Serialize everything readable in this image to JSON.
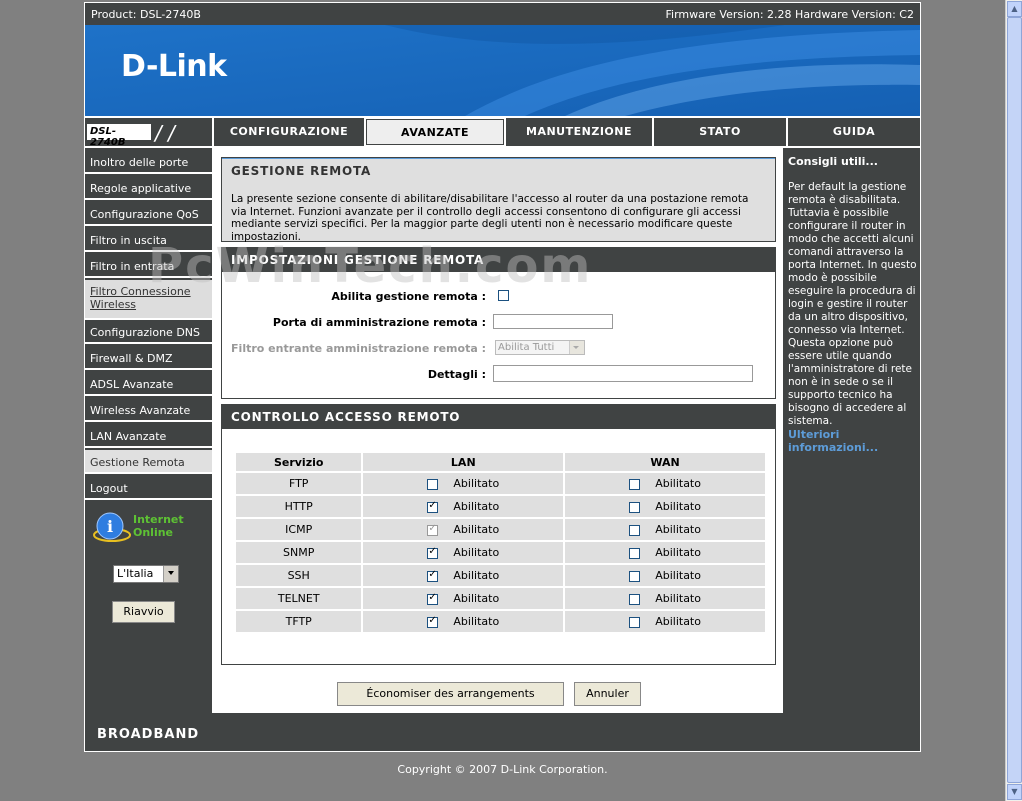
{
  "topbar": {
    "product": "Product: DSL-2740B",
    "versions": "Firmware Version: 2.28 Hardware Version: C2"
  },
  "banner": {
    "logo": "D-Link"
  },
  "tabs": {
    "model": "DSL-2740B",
    "items": [
      "CONFIGURAZIONE",
      "AVANZATE",
      "MANUTENZIONE",
      "STATO",
      "GUIDA"
    ],
    "active": "AVANZATE"
  },
  "leftnav": {
    "items": [
      "Inoltro delle porte",
      "Regole applicative",
      "Configurazione QoS",
      "Filtro in uscita",
      "Filtro in entrata",
      "Filtro Connessione Wireless",
      "Configurazione DNS",
      "Firewall & DMZ",
      "ADSL Avanzate",
      "Wireless Avanzate",
      "LAN Avanzate",
      "Gestione Remota",
      "Logout"
    ],
    "status_line1": "Internet",
    "status_line2": "Online",
    "language": "L'Italia",
    "reboot": "Riavvio"
  },
  "intro": {
    "title": "GESTIONE REMOTA",
    "text": "La presente sezione consente di abilitare/disabilitare l'accesso al router da una postazione remota via Internet. Funzioni avanzate per il controllo degli accessi consentono di configurare gli accessi mediante servizi specifici. Per la maggior parte degli utenti non è necessario modificare queste impostazioni."
  },
  "settings": {
    "title": "IMPOSTAZIONI GESTIONE REMOTA",
    "enable_label": "Abilita gestione remota :",
    "port_label": "Porta di amministrazione remota :",
    "port_value": "",
    "filter_label": "Filtro entrante amministrazione remota :",
    "filter_value": "Abilita Tutti",
    "details_label": "Dettagli :",
    "details_value": ""
  },
  "access": {
    "title": "CONTROLLO ACCESSO REMOTO",
    "headers": [
      "Servizio",
      "LAN",
      "WAN"
    ],
    "enabled_label": "Abilitato",
    "rows": [
      {
        "service": "FTP",
        "lan": false,
        "wan": false
      },
      {
        "service": "HTTP",
        "lan": true,
        "wan": false
      },
      {
        "service": "ICMP",
        "lan": true,
        "wan": false
      },
      {
        "service": "SNMP",
        "lan": true,
        "wan": false
      },
      {
        "service": "SSH",
        "lan": true,
        "wan": false
      },
      {
        "service": "TELNET",
        "lan": true,
        "wan": false
      },
      {
        "service": "TFTP",
        "lan": true,
        "wan": false
      }
    ]
  },
  "buttons": {
    "save": "Économiser des arrangements",
    "cancel": "Annuler"
  },
  "help": {
    "title": "Consigli utili...",
    "body": "Per default la gestione remota è disabilitata. Tuttavia è possibile configurare il router in modo che accetti alcuni comandi attraverso la porta Internet. In questo modo è possibile eseguire la procedura di login e gestire il router da un altro dispositivo, connesso via Internet. Questa opzione può essere utile quando l'amministratore di rete non è in sede o se il supporto tecnico ha bisogno di accedere al sistema.",
    "more": "Ulteriori informazioni..."
  },
  "footer": {
    "brand": "BROADBAND",
    "copyright": "Copyright © 2007 D-Link Corporation."
  },
  "watermark": "PcWinTech.com"
}
